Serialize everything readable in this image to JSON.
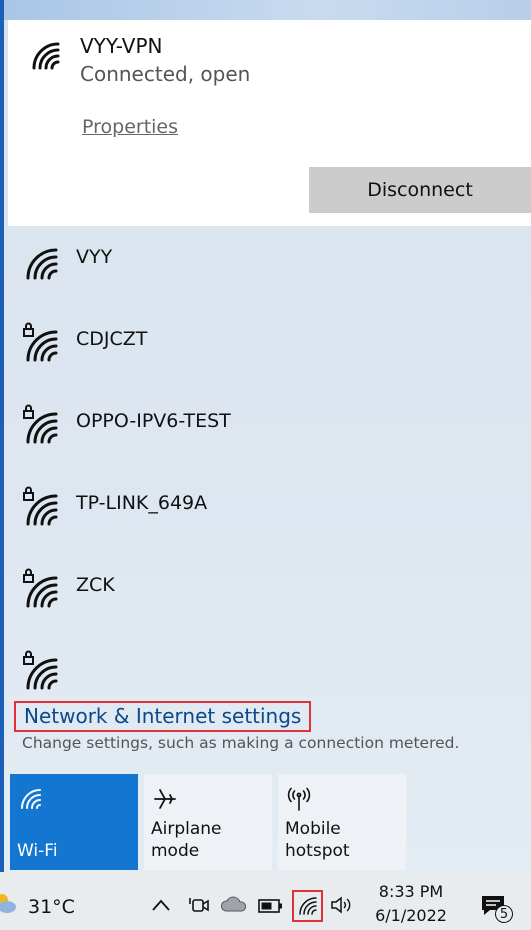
{
  "connected_network": {
    "ssid": "VYY-VPN",
    "status": "Connected, open",
    "properties_link": "Properties",
    "disconnect_label": "Disconnect"
  },
  "networks": [
    {
      "name": "VYY",
      "secured": false
    },
    {
      "name": "CDJCZT",
      "secured": true
    },
    {
      "name": "OPPO-IPV6-TEST",
      "secured": true
    },
    {
      "name": "TP-LINK_649A",
      "secured": true
    },
    {
      "name": "ZCK",
      "secured": true
    },
    {
      "name": "",
      "secured": true
    }
  ],
  "settings": {
    "link": "Network & Internet settings",
    "description": "Change settings, such as making a connection metered."
  },
  "quick_actions": [
    {
      "label": "Wi-Fi",
      "icon": "wifi-icon",
      "active": true
    },
    {
      "label": "Airplane mode",
      "icon": "airplane-icon",
      "active": false
    },
    {
      "label": "Mobile hotspot",
      "icon": "hotspot-icon",
      "active": false
    }
  ],
  "taskbar": {
    "temperature": "31°C",
    "weather_icon": "partly-sunny-icon",
    "time": "8:33 PM",
    "date": "6/1/2022",
    "notification_count": "5"
  },
  "colors": {
    "accent": "#1377d1",
    "highlight_border": "#e0313b",
    "link": "#0b4a8a"
  }
}
